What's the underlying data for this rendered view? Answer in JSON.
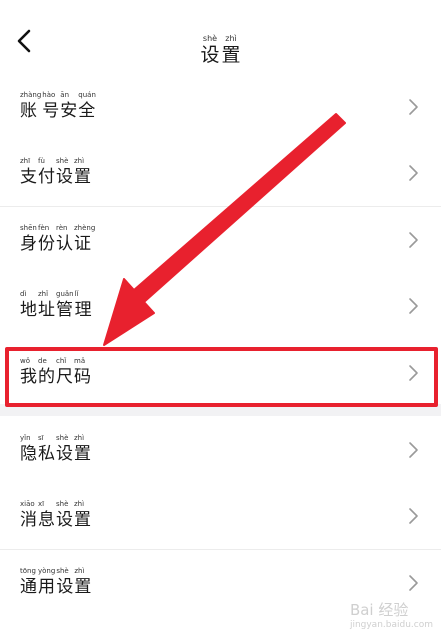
{
  "header": {
    "back_icon": "chevron-left-icon",
    "title": [
      {
        "py": "shè",
        "hz": "设"
      },
      {
        "py": "zhì",
        "hz": "置"
      }
    ]
  },
  "items": [
    {
      "chars": [
        {
          "py": "zhàng",
          "hz": "账"
        },
        {
          "py": "hào",
          "hz": "号"
        },
        {
          "py": "ān",
          "hz": "安"
        },
        {
          "py": "quán",
          "hz": "全"
        }
      ]
    },
    {
      "chars": [
        {
          "py": "zhī",
          "hz": "支"
        },
        {
          "py": "fù",
          "hz": "付"
        },
        {
          "py": "shè",
          "hz": "设"
        },
        {
          "py": "zhì",
          "hz": "置"
        }
      ]
    },
    {
      "chars": [
        {
          "py": "shēn",
          "hz": "身"
        },
        {
          "py": "fèn",
          "hz": "份"
        },
        {
          "py": "rèn",
          "hz": "认"
        },
        {
          "py": "zhèng",
          "hz": "证"
        }
      ]
    },
    {
      "chars": [
        {
          "py": "dì",
          "hz": "地"
        },
        {
          "py": "zhǐ",
          "hz": "址"
        },
        {
          "py": "guǎn",
          "hz": "管"
        },
        {
          "py": "lǐ",
          "hz": "理"
        }
      ]
    },
    {
      "chars": [
        {
          "py": "wǒ",
          "hz": "我"
        },
        {
          "py": "de",
          "hz": "的"
        },
        {
          "py": "chǐ",
          "hz": "尺"
        },
        {
          "py": "mǎ",
          "hz": "码"
        }
      ]
    },
    {
      "chars": [
        {
          "py": "yǐn",
          "hz": "隐"
        },
        {
          "py": "sī",
          "hz": "私"
        },
        {
          "py": "shè",
          "hz": "设"
        },
        {
          "py": "zhì",
          "hz": "置"
        }
      ]
    },
    {
      "chars": [
        {
          "py": "xiāo",
          "hz": "消"
        },
        {
          "py": "xī",
          "hz": "息"
        },
        {
          "py": "shè",
          "hz": "设"
        },
        {
          "py": "zhì",
          "hz": "置"
        }
      ]
    },
    {
      "chars": [
        {
          "py": "tōng",
          "hz": "通"
        },
        {
          "py": "yòng",
          "hz": "用"
        },
        {
          "py": "shè",
          "hz": "设"
        },
        {
          "py": "zhì",
          "hz": "置"
        }
      ]
    }
  ],
  "annotation": {
    "highlighted_item": "我的尺码",
    "color": "#e8212e"
  },
  "watermark": {
    "text": "Bai 经验",
    "sub": "jingyan.baidu.com"
  }
}
